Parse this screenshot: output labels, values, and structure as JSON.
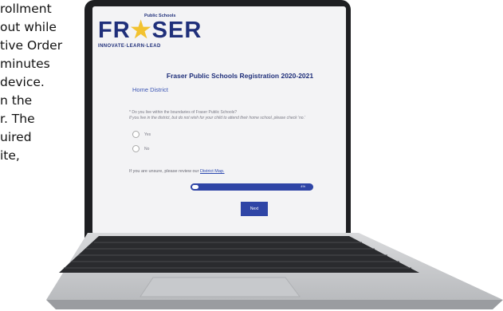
{
  "article": {
    "lines": [
      "rollment",
      "out while",
      "tive Order",
      "minutes",
      "device.",
      "n the",
      "r. The",
      "uired",
      "ite,"
    ]
  },
  "logo": {
    "top": "Public Schools",
    "mark_left": "FR",
    "mark_star": "★",
    "mark_right": "SER",
    "tagline": "INNOVATE·LEARN·LEAD"
  },
  "form": {
    "title": "Fraser Public Schools Registration 2020-2021",
    "section": "Home District",
    "question": "* Do you live within the boundaries of Fraser Public Schools?",
    "hint": "If you live in the district, but do not wish for your child to attend their home school, please check 'no.'",
    "options": [
      "Yes",
      "No"
    ],
    "note_prefix": "If you are unsure, please review our ",
    "note_link": "District Map.",
    "progress_label": "4%",
    "progress_value": 0.04,
    "next_label": "Next"
  },
  "colors": {
    "brand": "#1f2f7a",
    "accent": "#f2c230",
    "button": "#2f45a6"
  }
}
